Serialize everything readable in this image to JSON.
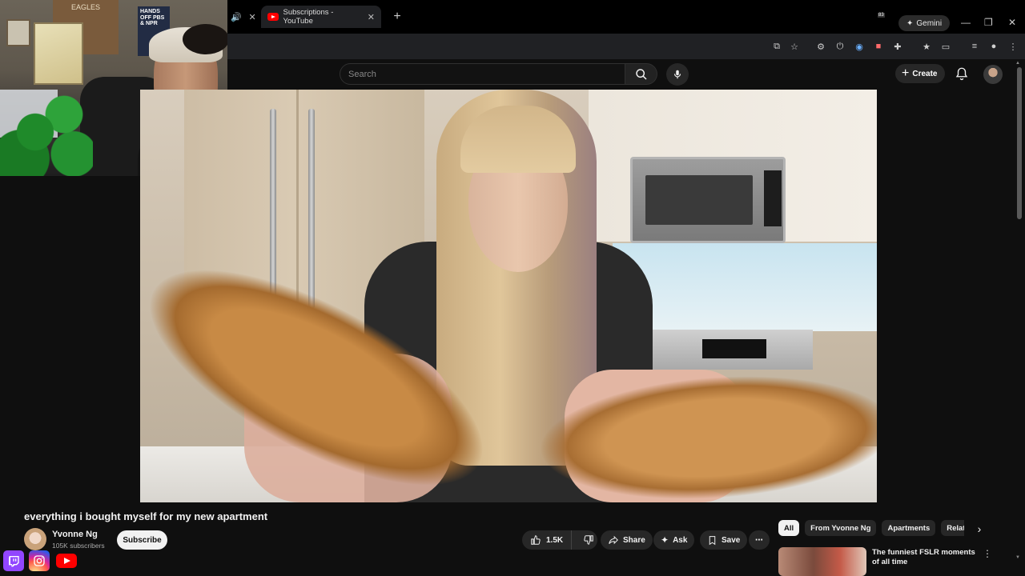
{
  "browser": {
    "tab_title": "Subscriptions - YouTube",
    "new_tab": "+",
    "gemini_label": "Gemini",
    "ext_badge": "83"
  },
  "header": {
    "search_placeholder": "Search",
    "create_label": "Create"
  },
  "webcam": {
    "sign_text": "EAGLES",
    "poster_text": "HANDS OFF PBS & NPR"
  },
  "video": {
    "title": "everything i bought myself for my new apartment",
    "channel_name": "Yvonne Ng",
    "subscribers": "105K subscribers",
    "subscribe_label": "Subscribe",
    "likes": "1.5K",
    "share_label": "Share",
    "ask_label": "Ask",
    "save_label": "Save"
  },
  "chips": [
    "All",
    "From Yvonne Ng",
    "Apartments",
    "Related"
  ],
  "recommendation": {
    "title": "The funniest FSLR moments of all time"
  },
  "colors": {
    "background": "#0f0f0f",
    "youtube_red": "#ff0000",
    "twitch_purple": "#9146ff"
  }
}
